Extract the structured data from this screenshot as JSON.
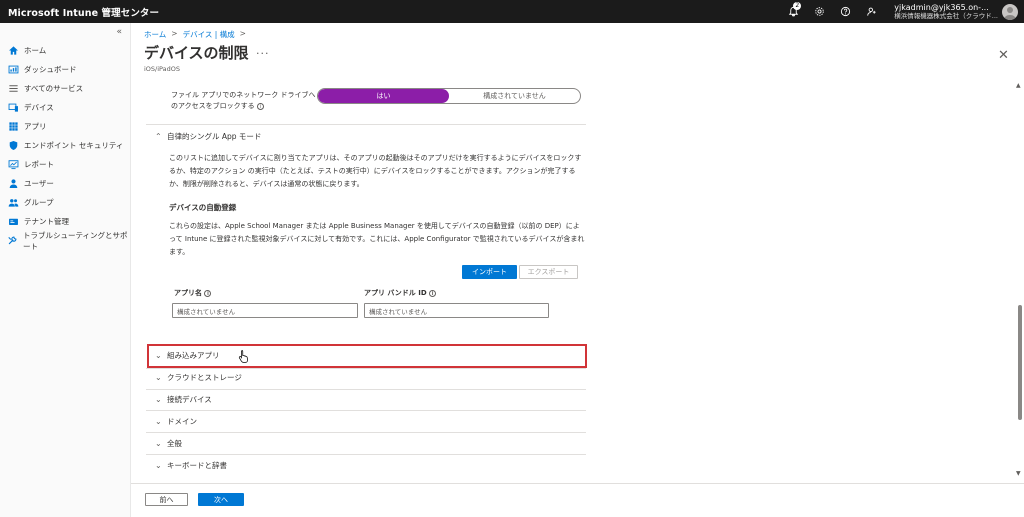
{
  "app": {
    "title": "Microsoft Intune 管理センター"
  },
  "topbar": {
    "notification_count": "2",
    "icons": [
      "bell-icon",
      "gear-icon",
      "help-icon",
      "feedback-icon"
    ],
    "account_name": "yjkadmin@yjk365.on-...",
    "account_org": "横浜情報機器株式会社（クラウド..."
  },
  "sidebar": {
    "collapse_glyph": "«",
    "items": [
      {
        "label": "ホーム",
        "icon": "home-icon"
      },
      {
        "label": "ダッシュボード",
        "icon": "dashboard-icon"
      },
      {
        "label": "すべてのサービス",
        "icon": "list-icon"
      },
      {
        "label": "デバイス",
        "icon": "device-icon"
      },
      {
        "label": "アプリ",
        "icon": "apps-grid-icon"
      },
      {
        "label": "エンドポイント セキュリティ",
        "icon": "shield-icon"
      },
      {
        "label": "レポート",
        "icon": "report-icon"
      },
      {
        "label": "ユーザー",
        "icon": "user-icon"
      },
      {
        "label": "グループ",
        "icon": "group-icon"
      },
      {
        "label": "テナント管理",
        "icon": "tenant-icon"
      },
      {
        "label": "トラブルシューティングとサポート",
        "icon": "wrench-icon"
      }
    ]
  },
  "breadcrumb": [
    "ホーム",
    "デバイス | 構成"
  ],
  "page": {
    "title": "デバイスの制限",
    "more": "...",
    "subtitle": "iOS/iPadOS",
    "close": "✕"
  },
  "content": {
    "file_setting_label": "ファイル アプリでのネットワーク ドライブへのアクセスをブロックする",
    "toggle_on": "はい",
    "toggle_off": "構成されていません",
    "autonomous_section": "自律的シングル App モード",
    "autonomous_desc": "このリストに追加してデバイスに割り当てたアプリは、そのアプリの起動後はそのアプリだけを実行するようにデバイスをロックするか、特定のアクション の実行中（たとえば、テストの実行中）にデバイスをロックすることができます。アクションが完了するか、制限が削除されると、デバイスは通常の状態に戻ります。",
    "auto_enroll_heading": "デバイスの自動登録",
    "auto_enroll_desc": "これらの設定は、Apple School Manager または Apple Business Manager を使用してデバイスの自動登録（以前の DEP）によって Intune に登録された監視対象デバイスに対して有効です。これには、Apple Configurator で監視されているデバイスが含まれます。",
    "import_label": "インポート",
    "export_label": "エクスポート",
    "app_name_label": "アプリ名",
    "bundle_id_label": "アプリ バンドル ID",
    "app_name_placeholder": "構成されていません",
    "bundle_id_placeholder": "構成されていません",
    "collapsed_sections": [
      "組み込みアプリ",
      "クラウドとストレージ",
      "接続デバイス",
      "ドメイン",
      "全般",
      "キーボードと辞書"
    ]
  },
  "footer": {
    "prev_label": "前へ",
    "next_label": "次へ"
  },
  "colors": {
    "accent_blue": "#0078d4",
    "toggle_purple": "#8c1ea8",
    "highlight_red": "#d13438"
  }
}
